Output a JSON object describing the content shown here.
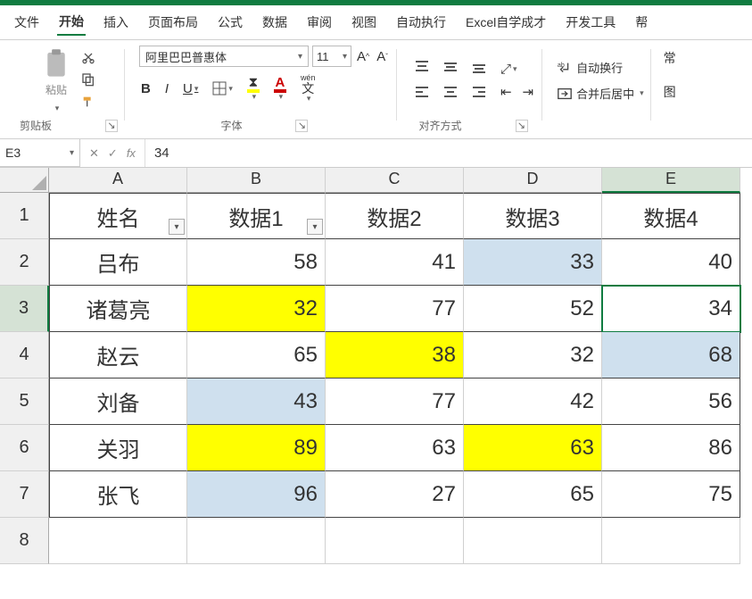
{
  "menu": {
    "items": [
      "文件",
      "开始",
      "插入",
      "页面布局",
      "公式",
      "数据",
      "审阅",
      "视图",
      "自动执行",
      "Excel自学成才",
      "开发工具"
    ],
    "active": 1,
    "overflow_hint": "帮"
  },
  "ribbon": {
    "clipboard": {
      "paste": "粘贴",
      "label": "剪贴板"
    },
    "font": {
      "name": "阿里巴巴普惠体",
      "size": "11",
      "label": "字体",
      "wen_label": "wén",
      "bold": "B",
      "italic": "I",
      "underline": "U",
      "char": "文",
      "charA": "A"
    },
    "align": {
      "label": "对齐方式"
    },
    "wrap": {
      "wrap_label": "自动换行",
      "merge_label": "合并后居中"
    },
    "cellstyles": {
      "hint": "常",
      "fmt": "图"
    }
  },
  "formula": {
    "namebox": "E3",
    "value": "34",
    "fx": "fx"
  },
  "sheet": {
    "col_letters": [
      "A",
      "B",
      "C",
      "D",
      "E"
    ],
    "row_nums": [
      "1",
      "2",
      "3",
      "4",
      "5",
      "6",
      "7",
      "8"
    ],
    "selected_col_index": 4,
    "selected_row_index": 2,
    "headers": [
      "姓名",
      "数据1",
      "数据2",
      "数据3",
      "数据4"
    ],
    "rows": [
      {
        "name": "吕布",
        "cells": [
          {
            "v": "58"
          },
          {
            "v": "41"
          },
          {
            "v": "33",
            "bg": "blue"
          },
          {
            "v": "40"
          }
        ]
      },
      {
        "name": "诸葛亮",
        "cells": [
          {
            "v": "32",
            "bg": "yellow"
          },
          {
            "v": "77"
          },
          {
            "v": "52"
          },
          {
            "v": "34",
            "sel": true
          }
        ]
      },
      {
        "name": "赵云",
        "cells": [
          {
            "v": "65"
          },
          {
            "v": "38",
            "bg": "yellow"
          },
          {
            "v": "32"
          },
          {
            "v": "68",
            "bg": "blue"
          }
        ]
      },
      {
        "name": "刘备",
        "cells": [
          {
            "v": "43",
            "bg": "blue"
          },
          {
            "v": "77"
          },
          {
            "v": "42"
          },
          {
            "v": "56"
          }
        ]
      },
      {
        "name": "关羽",
        "cells": [
          {
            "v": "89",
            "bg": "yellow"
          },
          {
            "v": "63"
          },
          {
            "v": "63",
            "bg": "yellow"
          },
          {
            "v": "86"
          }
        ]
      },
      {
        "name": "张飞",
        "cells": [
          {
            "v": "96",
            "bg": "blue"
          },
          {
            "v": "27"
          },
          {
            "v": "65"
          },
          {
            "v": "75"
          }
        ]
      }
    ]
  },
  "chart_data": {
    "type": "table",
    "title": "",
    "columns": [
      "姓名",
      "数据1",
      "数据2",
      "数据3",
      "数据4"
    ],
    "rows": [
      [
        "吕布",
        58,
        41,
        33,
        40
      ],
      [
        "诸葛亮",
        32,
        77,
        52,
        34
      ],
      [
        "赵云",
        65,
        38,
        32,
        68
      ],
      [
        "刘备",
        43,
        77,
        42,
        56
      ],
      [
        "关羽",
        89,
        63,
        63,
        86
      ],
      [
        "张飞",
        96,
        27,
        65,
        75
      ]
    ]
  }
}
